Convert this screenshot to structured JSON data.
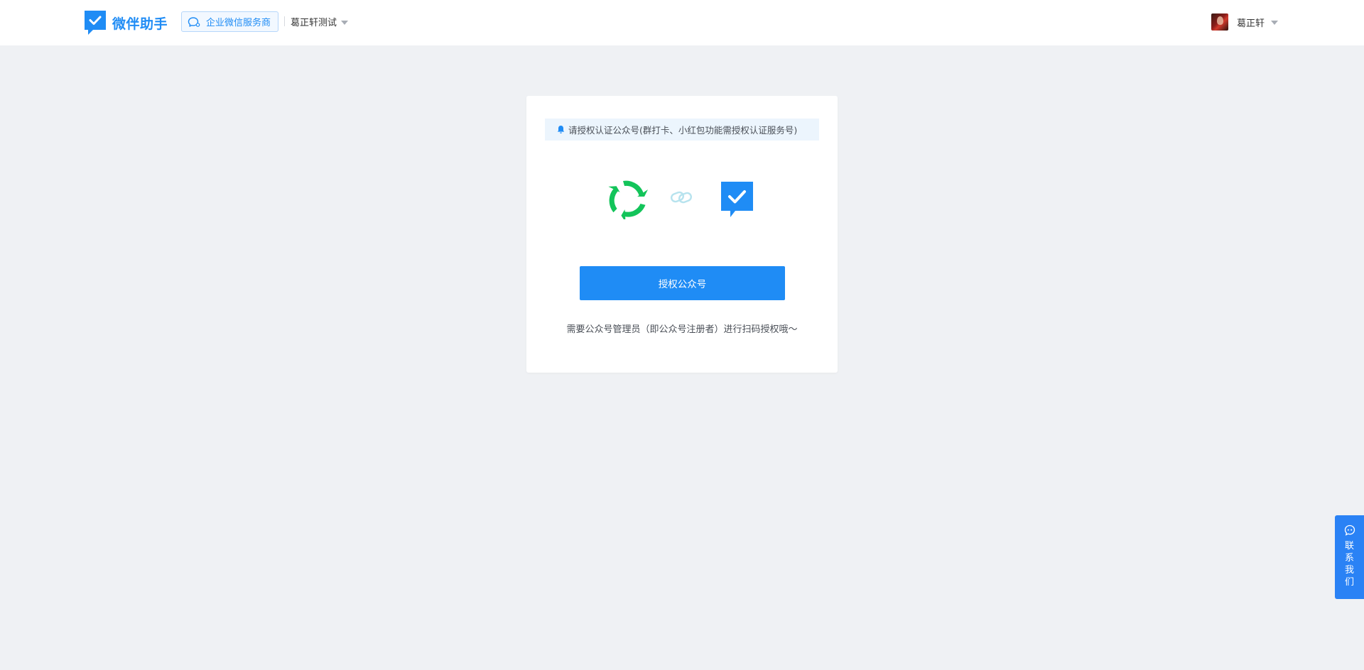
{
  "header": {
    "brand": {
      "name": "微伴助手",
      "logo_icon": "checkmark-chat-icon"
    },
    "partner_badge": {
      "label": "企业微信服务商",
      "icon": "chat-bubble-icon"
    },
    "org_select": {
      "value": "葛正轩测试"
    },
    "user": {
      "name": "葛正轩"
    }
  },
  "card": {
    "notice": "请授权认证公众号(群打卡、小红包功能需授权认证服务号)",
    "icons": [
      "wechat-logo-icon",
      "link-icon",
      "checkmark-chat-icon"
    ],
    "auth_button": "授权公众号",
    "hint": "需要公众号管理员（即公众号注册者）进行扫码授权哦～"
  },
  "contact": {
    "label_chars": [
      "联",
      "系",
      "我",
      "们"
    ],
    "icon": "chat-face-icon"
  },
  "colors": {
    "accent": "#1f8cf5",
    "page_bg": "#eff1f4",
    "wechat_green": "#13c45a",
    "notice_bg": "#ecf5fd"
  }
}
